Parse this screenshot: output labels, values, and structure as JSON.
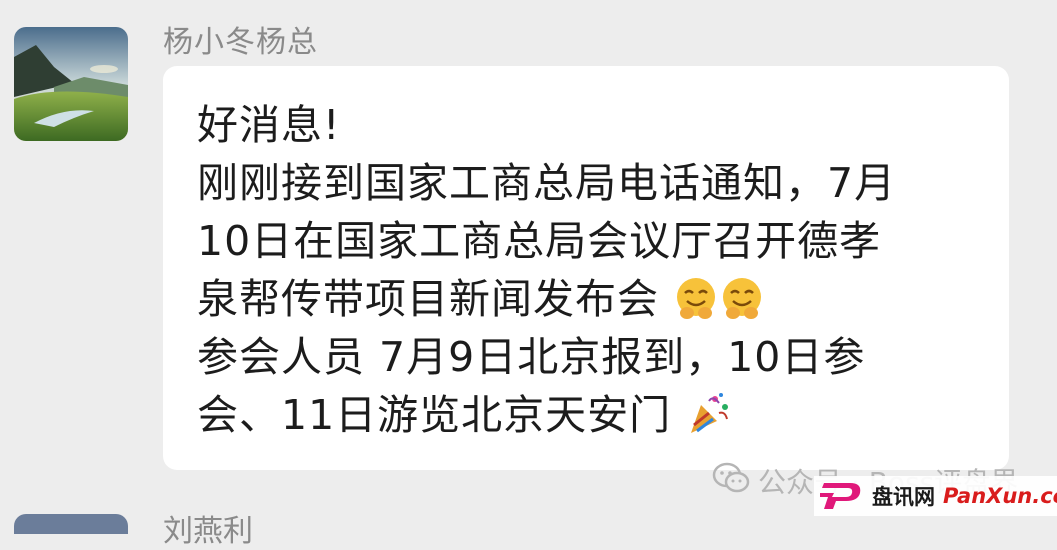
{
  "sender": {
    "name": "杨小冬杨总"
  },
  "message": {
    "lines": [
      "好消息!",
      "刚刚接到国家工商总局电话通知，7月",
      "10日在国家工商总局会议厅召开德孝",
      "泉帮传带项目新闻发布会",
      "参会人员 7月9日北京报到，10日参",
      "会、11日游览北京天安门"
    ],
    "emojis": {
      "line4": [
        "beaming-face-emoji",
        "beaming-face-emoji"
      ],
      "line6": [
        "party-popper-emoji"
      ]
    }
  },
  "watermark": {
    "text": "公众号 · Boss评盘界"
  },
  "next_sender": {
    "name": "刘燕利"
  },
  "brand": {
    "name": "盘讯网",
    "url": "PanXun.cc"
  },
  "colors": {
    "background": "#ededed",
    "bubble": "#ffffff",
    "name": "#8a8a8a",
    "text": "#1c1c1c",
    "brand_red": "#d91c1c",
    "brand_magenta": "#e0187a"
  }
}
